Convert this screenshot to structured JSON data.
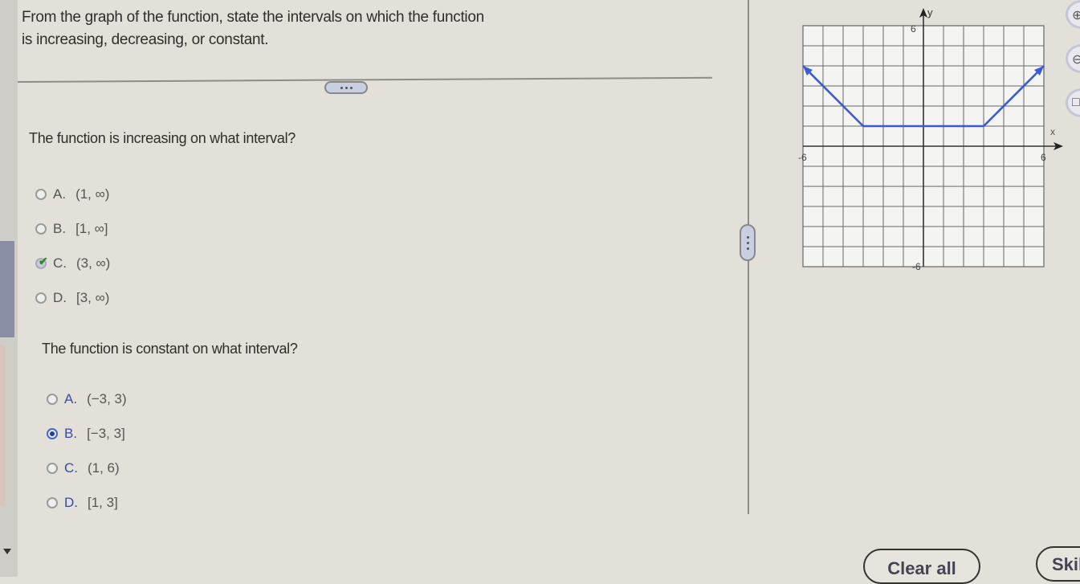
{
  "prompt": {
    "line1": "From the graph of the function, state the   intervals on which the function",
    "line2": "is increasing, decreasing, or constant."
  },
  "questions": [
    {
      "text": "The function is increasing on what interval?",
      "options": [
        {
          "letter": "A.",
          "value": "(1, ∞)",
          "state": "unselected"
        },
        {
          "letter": "B.",
          "value": "[1, ∞]",
          "state": "unselected"
        },
        {
          "letter": "C.",
          "value": "(3, ∞)",
          "state": "correct-checked"
        },
        {
          "letter": "D.",
          "value": "[3, ∞)",
          "state": "unselected"
        }
      ],
      "check_icon": "✔"
    },
    {
      "text": "The function is constant on what interval?",
      "options": [
        {
          "letter": "A.",
          "value": "(−3, 3)",
          "state": "unselected"
        },
        {
          "letter": "B.",
          "value": "[−3, 3]",
          "state": "selected"
        },
        {
          "letter": "C.",
          "value": "(1, 6)",
          "state": "unselected"
        },
        {
          "letter": "D.",
          "value": "[1, 3]",
          "state": "unselected"
        }
      ]
    }
  ],
  "graph": {
    "x_label": "x",
    "y_label": "y",
    "x_min_label": "-6",
    "x_max_label": "6",
    "y_max_label": "6",
    "y_min_label": "-6",
    "x_range": [
      -6,
      6
    ],
    "y_range": [
      -6,
      6
    ],
    "grid_step": 1,
    "line_color": "#3a5bd6",
    "points": [
      [
        -6,
        4
      ],
      [
        -3,
        1
      ],
      [
        3,
        1
      ],
      [
        6,
        4
      ]
    ],
    "arrow_start": true,
    "arrow_end": true
  },
  "buttons": {
    "clear_all": "Clear all",
    "skip": "Skil"
  },
  "tools": [
    "⊕",
    "⊖",
    "□"
  ],
  "expander_dots": "..."
}
